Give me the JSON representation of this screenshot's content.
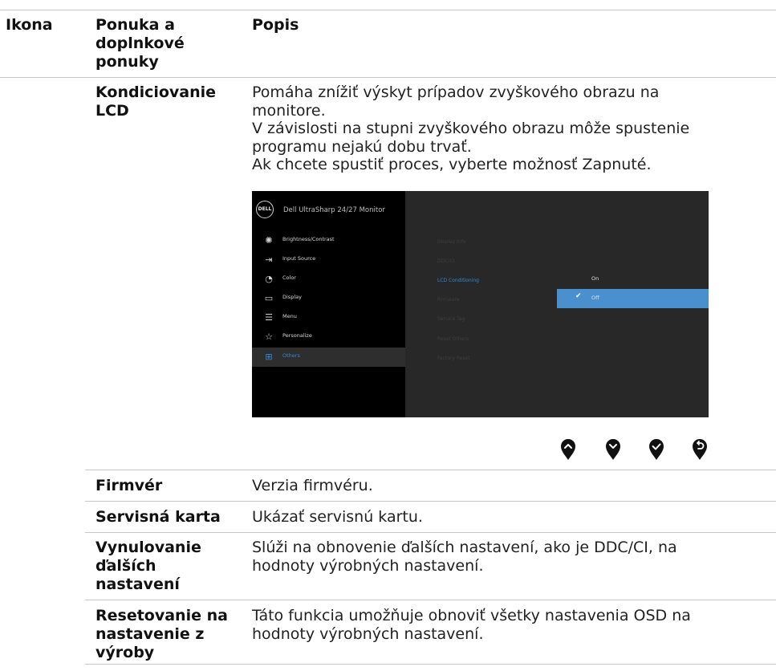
{
  "headers": {
    "icon": "Ikona",
    "menu": "Ponuka a doplnkové ponuky",
    "desc": "Popis"
  },
  "rows": {
    "lcd": {
      "term": "Kondiciovanie LCD",
      "lines": [
        "Pomáha znížiť výskyt prípadov zvyškového obrazu na",
        "monitore.",
        "V závislosti na stupni zvyškového obrazu môže spustenie",
        "programu nejakú dobu trvať.",
        "Ak chcete spustiť proces, vyberte možnosť Zapnuté."
      ]
    },
    "firmware": {
      "term": "Firmvér",
      "desc": "Verzia firmvéru."
    },
    "service": {
      "term": "Servisná karta",
      "desc": "Ukázať servisnú kartu."
    },
    "reset_others": {
      "term_lines": [
        "Vynulovanie",
        "ďalších",
        "nastavení"
      ],
      "desc_lines": [
        "Slúži na obnovenie ďalších nastavení, ako je DDC/CI, na",
        "hodnoty výrobných nastavení."
      ]
    },
    "factory": {
      "term_lines": [
        "Resetovanie na",
        "nastavenie z",
        "výroby"
      ],
      "desc_lines": [
        "Táto funkcia umožňuje obnoviť všetky nastavenia OSD na",
        "hodnoty výrobných nastavení."
      ]
    }
  },
  "osd": {
    "logo": "DELL",
    "model": "Dell UltraSharp 24/27 Monitor",
    "menu": [
      {
        "label": "Brightness/Contrast",
        "icon": "brightness-icon"
      },
      {
        "label": "Input Source",
        "icon": "input-source-icon"
      },
      {
        "label": "Color",
        "icon": "color-palette-icon"
      },
      {
        "label": "Display",
        "icon": "display-icon"
      },
      {
        "label": "Menu",
        "icon": "menu-icon"
      },
      {
        "label": "Personalize",
        "icon": "star-icon"
      },
      {
        "label": "Others",
        "icon": "others-icon",
        "selected": true
      }
    ],
    "submenu": [
      "Display Info",
      "DDC/CI",
      "LCD Conditioning",
      "Firmware",
      "Service Tag",
      "Reset Others",
      "Factory Reset"
    ],
    "submenu_active": "LCD Conditioning",
    "options": [
      {
        "label": "On",
        "selected": false
      },
      {
        "label": "Off",
        "selected": true
      }
    ],
    "buttons": [
      "up-button-icon",
      "down-button-icon",
      "confirm-button-icon",
      "back-button-icon"
    ]
  }
}
